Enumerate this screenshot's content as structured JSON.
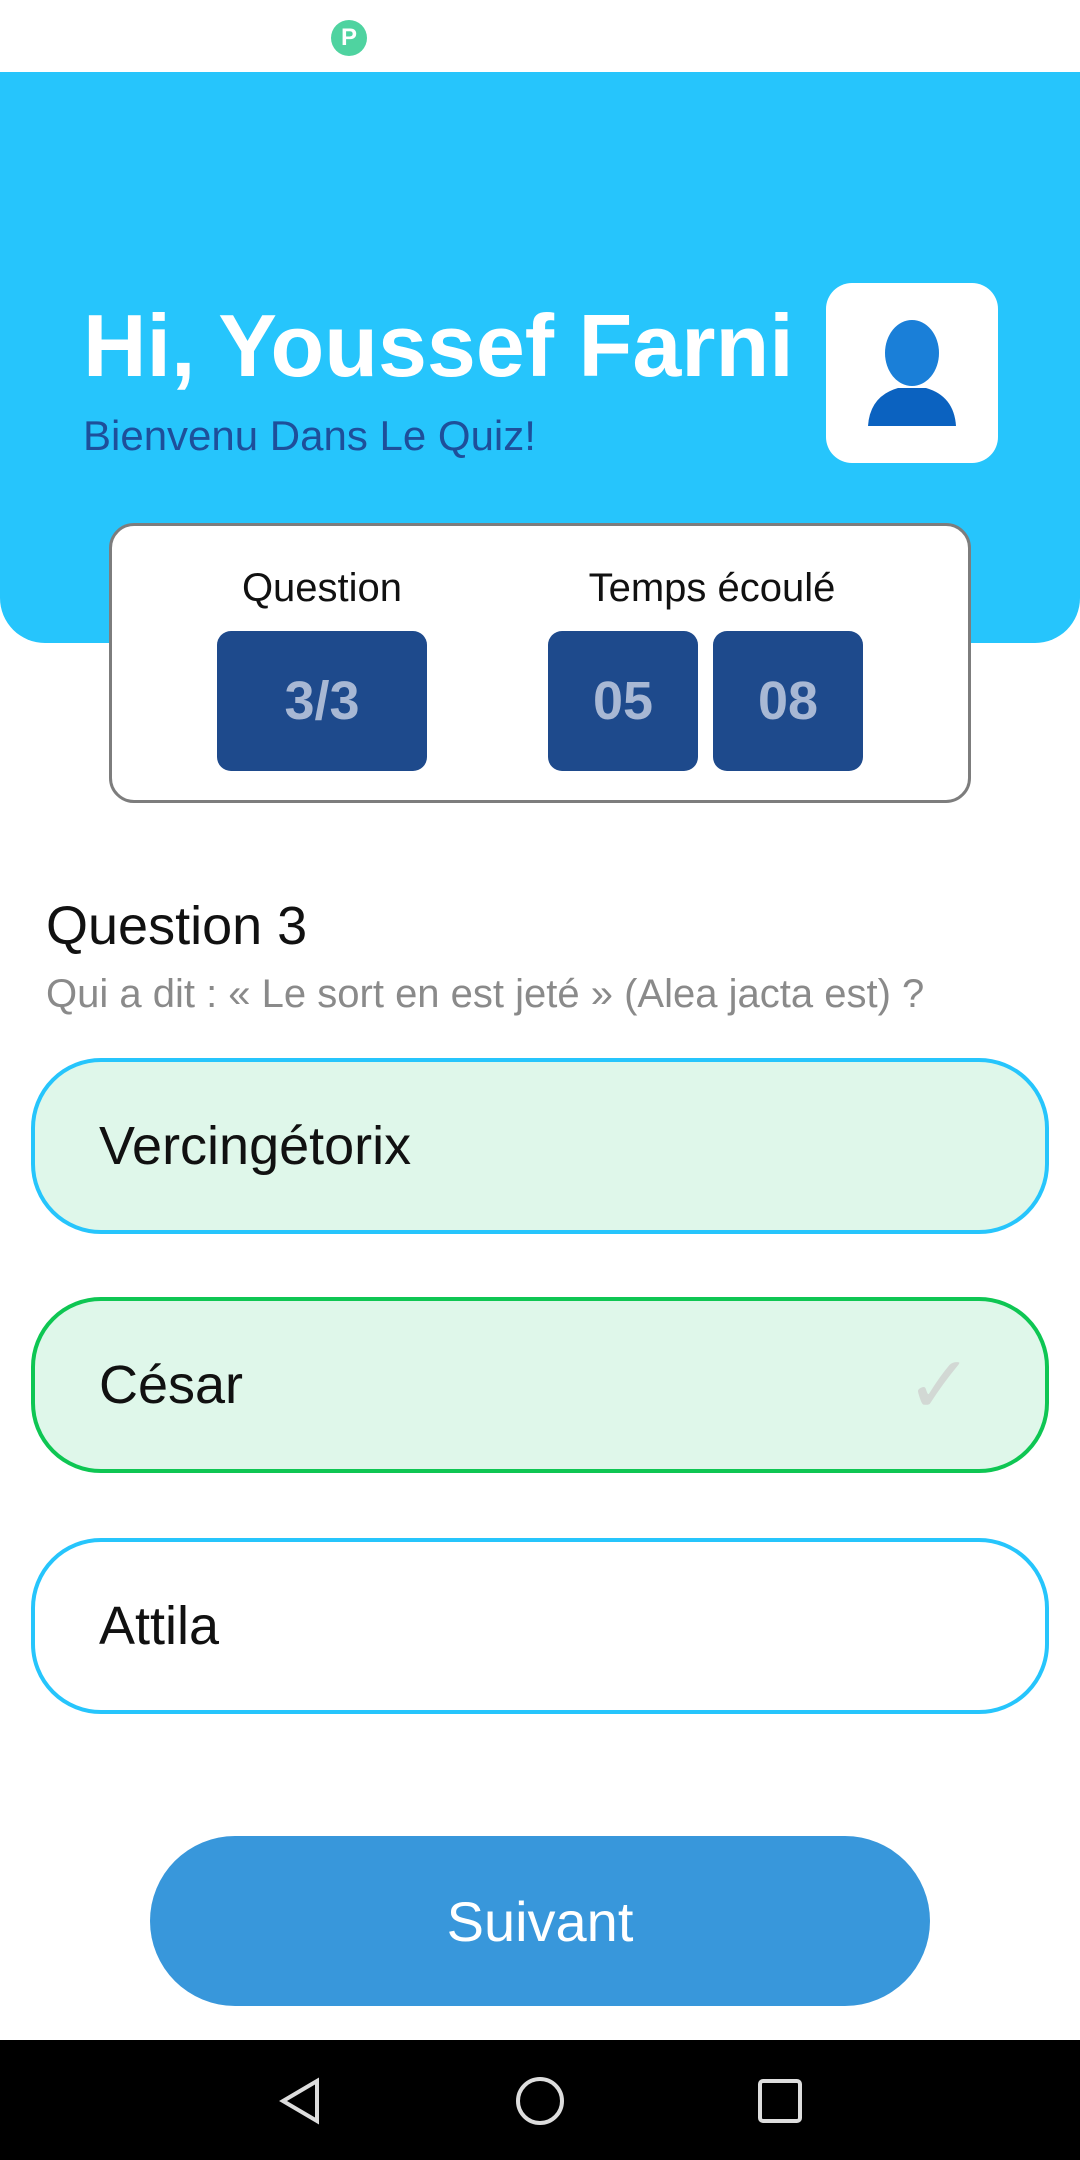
{
  "header": {
    "title": "Hi, Youssef Farni",
    "subtitle": "Bienvenu Dans Le Quiz!"
  },
  "stats": {
    "question_label": "Question",
    "question_value": "3/3",
    "time_label": "Temps écoulé",
    "minutes": "05",
    "seconds": "08"
  },
  "question": {
    "heading": "Question 3",
    "text": "Qui a dit : « Le sort en est jeté » (Alea jacta est) ?"
  },
  "options": [
    {
      "label": "Vercingétorix",
      "state": "selected"
    },
    {
      "label": "César",
      "state": "correct"
    },
    {
      "label": "Attila",
      "state": "default"
    }
  ],
  "next_label": "Suivant",
  "colors": {
    "header": "#26c5fc",
    "box": "#1e4a8c",
    "correct": "#0ec653",
    "button": "#3897db"
  }
}
